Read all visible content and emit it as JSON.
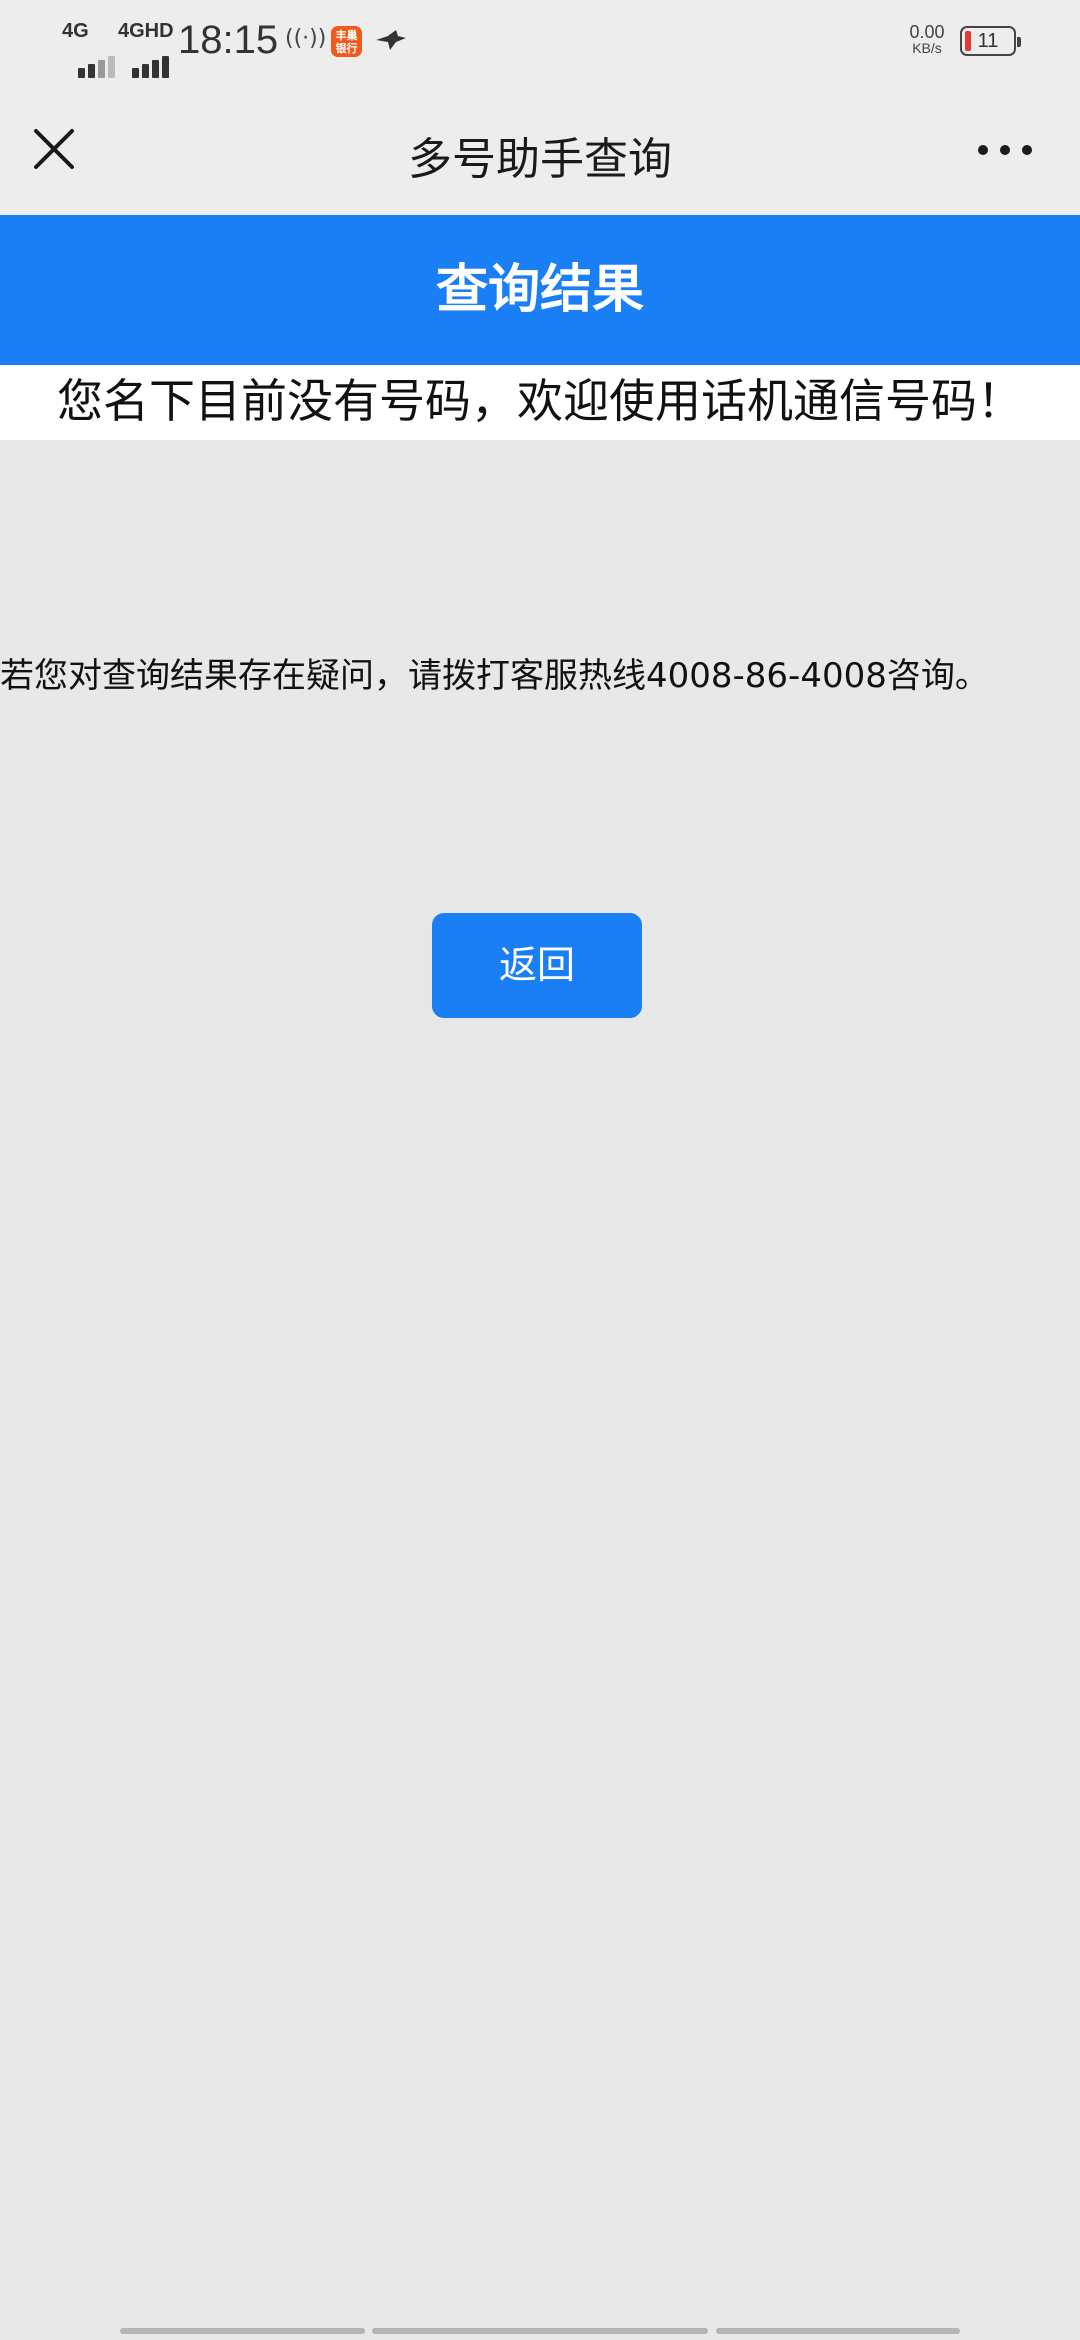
{
  "status_bar": {
    "network1": "4G",
    "network2": "4GHD",
    "time": "18:15",
    "hotspot_glyph": "((·))",
    "app_icon_label": "丰巢\n银行",
    "speed_value": "0.00",
    "speed_unit": "KB/s",
    "battery_level": "11",
    "battery_color": "#e53935"
  },
  "nav": {
    "title": "多号助手查询"
  },
  "header": {
    "title": "查询结果"
  },
  "result": {
    "message": "您名下目前没有号码，欢迎使用话机通信号码！",
    "hotline_note": "若您对查询结果存在疑问，请拨打客服热线4008-86-4008咨询。"
  },
  "actions": {
    "back_label": "返回"
  },
  "colors": {
    "accent": "#1a7ef5",
    "background": "#e8e8e8"
  }
}
